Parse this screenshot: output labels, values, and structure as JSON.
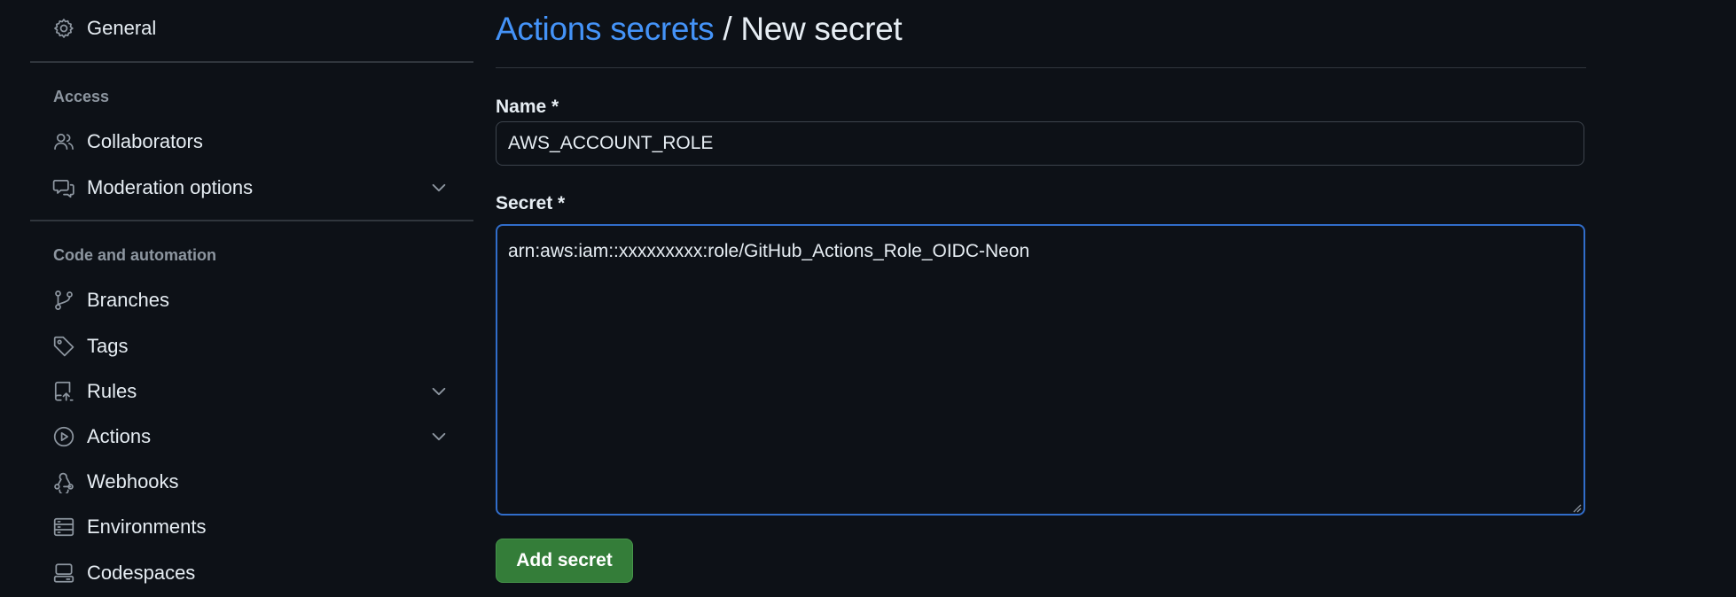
{
  "sidebar": {
    "top_item": {
      "label": "General",
      "icon": "gear-icon"
    },
    "sections": [
      {
        "heading": "Access",
        "items": [
          {
            "label": "Collaborators",
            "icon": "people-icon"
          },
          {
            "label": "Moderation options",
            "icon": "comment-discussion-icon",
            "expandable": true
          }
        ]
      },
      {
        "heading": "Code and automation",
        "items": [
          {
            "label": "Branches",
            "icon": "git-branch-icon"
          },
          {
            "label": "Tags",
            "icon": "tag-icon"
          },
          {
            "label": "Rules",
            "icon": "repo-push-icon",
            "expandable": true
          },
          {
            "label": "Actions",
            "icon": "play-icon",
            "expandable": true
          },
          {
            "label": "Webhooks",
            "icon": "webhook-icon"
          },
          {
            "label": "Environments",
            "icon": "server-icon"
          },
          {
            "label": "Codespaces",
            "icon": "codespaces-icon"
          }
        ]
      }
    ]
  },
  "main": {
    "breadcrumb": {
      "parent": "Actions secrets",
      "separator": "/",
      "current": "New secret"
    },
    "name_field": {
      "label": "Name *",
      "value": "AWS_ACCOUNT_ROLE"
    },
    "secret_field": {
      "label": "Secret *",
      "value": "arn:aws:iam::xxxxxxxxx:role/GitHub_Actions_Role_OIDC-Neon"
    },
    "submit_label": "Add secret"
  },
  "colors": {
    "background": "#0d1117",
    "link": "#4493f8",
    "focus_border": "#316dca",
    "primary_button": "#347d39",
    "muted": "#8d96a0",
    "border": "#30363d"
  }
}
